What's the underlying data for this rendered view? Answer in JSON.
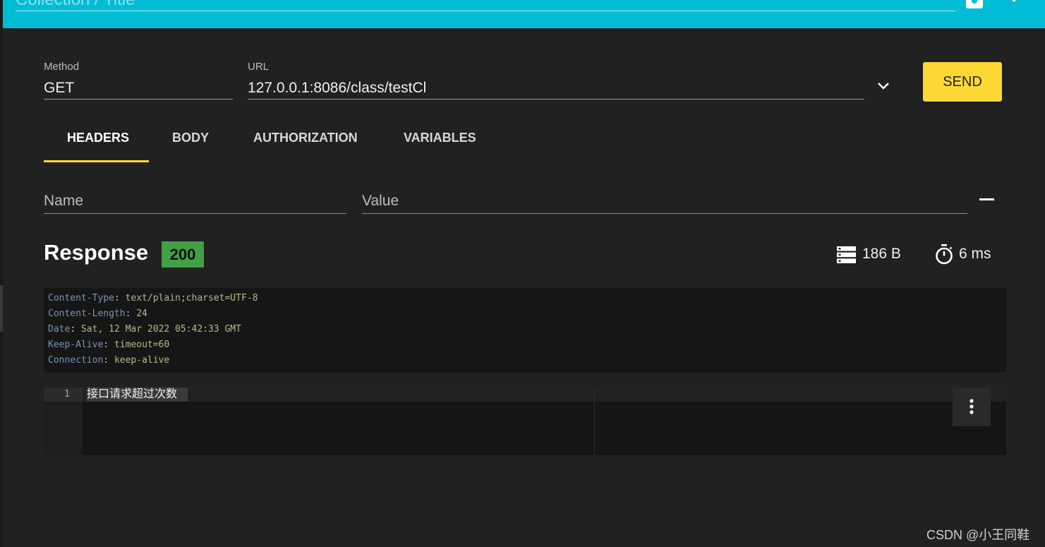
{
  "title_bar": {
    "collection_title": "Collection / Title"
  },
  "request": {
    "method_label": "Method",
    "method_value": "GET",
    "url_label": "URL",
    "url_value": "127.0.0.1:8086/class/testCl",
    "send_label": "SEND"
  },
  "tabs": [
    {
      "label": "HEADERS",
      "active": true
    },
    {
      "label": "BODY",
      "active": false
    },
    {
      "label": "AUTHORIZATION",
      "active": false
    },
    {
      "label": "VARIABLES",
      "active": false
    }
  ],
  "headers_editor": {
    "name_placeholder": "Name",
    "value_placeholder": "Value"
  },
  "response": {
    "title": "Response",
    "status": "200",
    "size": "186 B",
    "time": "6 ms",
    "headers": [
      {
        "key": "Content-Type",
        "value": "text/plain;charset=UTF-8"
      },
      {
        "key": "Content-Length",
        "value": "24"
      },
      {
        "key": "Date",
        "value": "Sat, 12 Mar 2022 05:42:33 GMT"
      },
      {
        "key": "Keep-Alive",
        "value": "timeout=60"
      },
      {
        "key": "Connection",
        "value": "keep-alive"
      }
    ],
    "body_line_number": "1",
    "body_text": "接口请求超过次数"
  },
  "watermark": "CSDN @小王同鞋",
  "colors": {
    "topbar": "#00bcd4",
    "background": "#212121",
    "accent": "#fdd835",
    "status_ok": "#43a047"
  },
  "icons": [
    "save-icon",
    "more-vert-icon",
    "chevron-down-icon",
    "remove-icon",
    "storage-icon",
    "timer-icon"
  ]
}
